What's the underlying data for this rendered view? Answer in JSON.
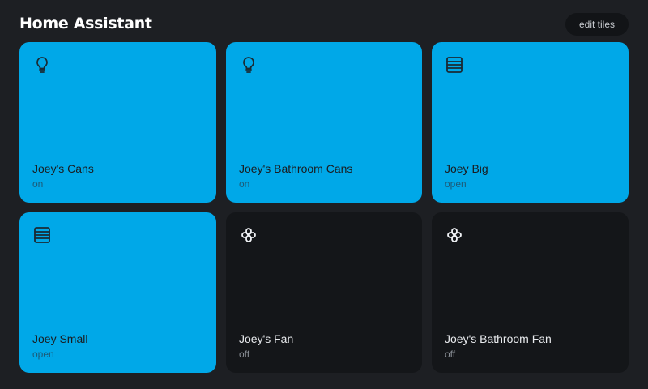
{
  "header": {
    "title": "Home Assistant",
    "edit_label": "edit tiles"
  },
  "colors": {
    "background": "#1d1f23",
    "tile_active": "#00a8e8",
    "tile_inactive": "#141619"
  },
  "tiles": [
    {
      "name": "Joey's Cans",
      "state": "on",
      "icon": "bulb-icon",
      "active": true
    },
    {
      "name": "Joey's Bathroom Cans",
      "state": "on",
      "icon": "bulb-icon",
      "active": true
    },
    {
      "name": "Joey Big",
      "state": "open",
      "icon": "blinds-icon",
      "active": true
    },
    {
      "name": "Joey Small",
      "state": "open",
      "icon": "blinds-icon",
      "active": true
    },
    {
      "name": "Joey's Fan",
      "state": "off",
      "icon": "fan-icon",
      "active": false
    },
    {
      "name": "Joey's Bathroom Fan",
      "state": "off",
      "icon": "fan-icon",
      "active": false
    }
  ]
}
